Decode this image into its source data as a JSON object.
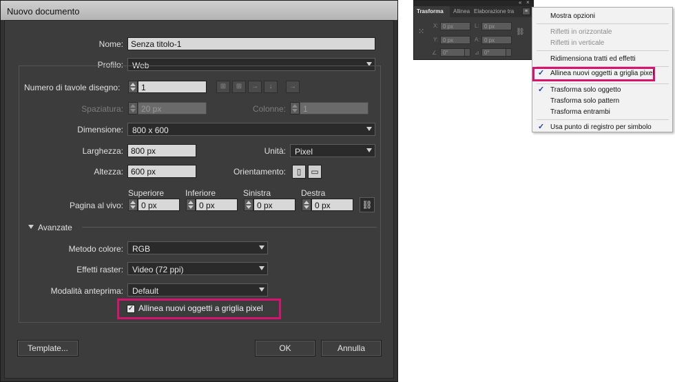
{
  "dialog": {
    "title": "Nuovo documento",
    "name_label": "Nome:",
    "name_value": "Senza titolo-1",
    "profile_label": "Profilo:",
    "profile_value": "Web",
    "artboards_label": "Numero di tavole disegno:",
    "artboards_value": "1",
    "spacing_label": "Spaziatura:",
    "spacing_value": "20 px",
    "columns_label": "Colonne:",
    "columns_value": "1",
    "size_label": "Dimensione:",
    "size_value": "800 x 600",
    "width_label": "Larghezza:",
    "width_value": "800 px",
    "units_label": "Unità:",
    "units_value": "Pixel",
    "height_label": "Altezza:",
    "height_value": "600 px",
    "orientation_label": "Orientamento:",
    "bleed_label": "Pagina al vivo:",
    "bleed": {
      "top_label": "Superiore",
      "top_value": "0 px",
      "bottom_label": "Inferiore",
      "bottom_value": "0 px",
      "left_label": "Sinistra",
      "left_value": "0 px",
      "right_label": "Destra",
      "right_value": "0 px"
    },
    "advanced_label": "Avanzate",
    "color_mode_label": "Metodo colore:",
    "color_mode_value": "RGB",
    "raster_label": "Effetti raster:",
    "raster_value": "Video (72 ppi)",
    "preview_label": "Modalità anteprima:",
    "preview_value": "Default",
    "align_checkbox_label": "Allinea nuovi oggetti a griglia pixel",
    "align_checked": true,
    "template_button": "Template...",
    "ok_button": "OK",
    "cancel_button": "Annulla"
  },
  "panel": {
    "tabs": [
      "Trasforma",
      "Allinea",
      "Elaborazione tra"
    ],
    "fields": {
      "x_label": "X:",
      "x_value": "0 px",
      "y_label": "Y:",
      "y_value": "0 px",
      "l_label": "L:",
      "l_value": "0 px",
      "a_label": "A:",
      "a_value": "0 px",
      "rot_value": "0°",
      "shear_value": "0°"
    }
  },
  "menu": {
    "items": [
      {
        "label": "Mostra opzioni",
        "disabled": false,
        "checked": false
      },
      {
        "label": "Rifletti in orizzontale",
        "disabled": true,
        "checked": false
      },
      {
        "label": "Rifletti in verticale",
        "disabled": true,
        "checked": false
      },
      {
        "label": "Ridimensiona tratti ed effetti",
        "disabled": false,
        "checked": false
      },
      {
        "label": "Allinea nuovi oggetti a griglia pixel",
        "disabled": false,
        "checked": true
      },
      {
        "label": "Trasforma solo oggetto",
        "disabled": false,
        "checked": true
      },
      {
        "label": "Trasforma solo pattern",
        "disabled": false,
        "checked": false
      },
      {
        "label": "Trasforma entrambi",
        "disabled": false,
        "checked": false
      },
      {
        "label": "Usa punto di registro per simbolo",
        "disabled": false,
        "checked": true
      }
    ],
    "check_glyph": "✓"
  },
  "colors": {
    "highlight": "#d6146f",
    "dialog_bg": "#3c3c3c",
    "menu_check": "#1a3ea8"
  }
}
